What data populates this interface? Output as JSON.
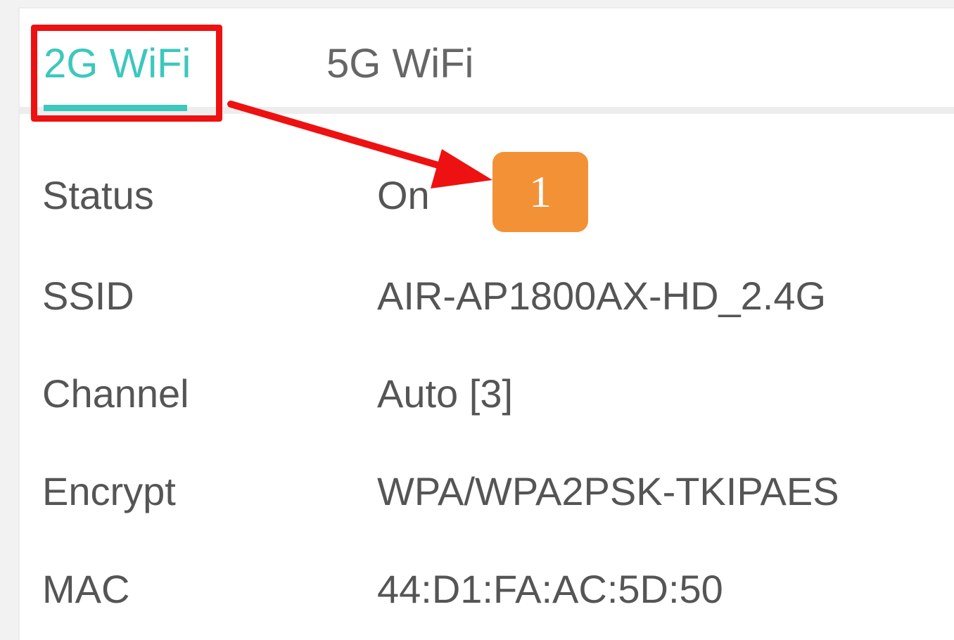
{
  "tabs": [
    {
      "label": "2G WiFi",
      "active": true
    },
    {
      "label": "5G WiFi",
      "active": false
    }
  ],
  "rows": [
    {
      "label": "Status",
      "value": "On"
    },
    {
      "label": "SSID",
      "value": "AIR-AP1800AX-HD_2.4G"
    },
    {
      "label": "Channel",
      "value": "Auto [3]"
    },
    {
      "label": "Encrypt",
      "value": "WPA/WPA2PSK-TKIPAES"
    },
    {
      "label": "MAC",
      "value": "44:D1:FA:AC:5D:50"
    }
  ],
  "annotation": {
    "step_number": "1",
    "badge_color": "#f39137",
    "highlight_color": "#ee1111"
  },
  "colors": {
    "accent": "#3cc8bd",
    "text": "#555555"
  }
}
